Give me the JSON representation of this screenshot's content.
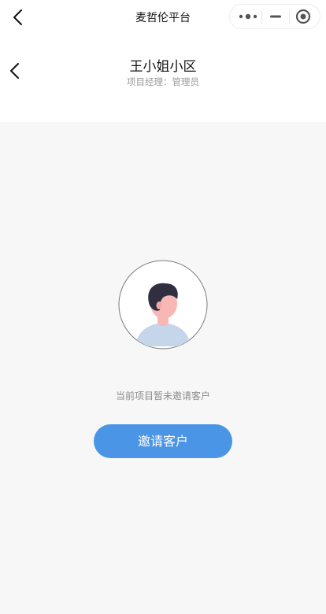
{
  "navbar": {
    "title": "麦哲伦平台",
    "back_icon": "chevron-left-icon",
    "capsule": {
      "more_icon": "more-dots-icon",
      "minimize_icon": "minimize-icon",
      "close_icon": "target-close-icon"
    }
  },
  "header": {
    "back_icon": "chevron-left-icon",
    "title": "王小姐小区",
    "subtitle": "项目经理：管理员"
  },
  "empty_state": {
    "avatar_icon": "user-avatar-illustration",
    "message": "当前项目暂未邀请客户"
  },
  "actions": {
    "invite_label": "邀请客户"
  },
  "colors": {
    "accent": "#4a95e5",
    "background": "#f7f7f7",
    "surface": "#ffffff",
    "muted_text": "#8c8c8c",
    "hair": "#2f2f3f",
    "skin": "#f6b7b5",
    "shirt": "#c5d6ea"
  }
}
